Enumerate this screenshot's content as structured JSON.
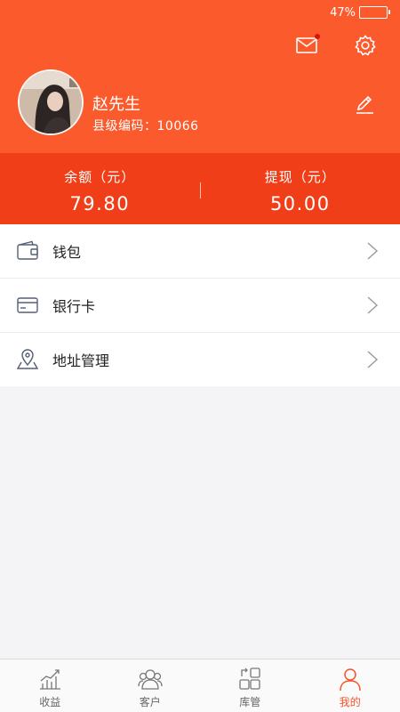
{
  "status_bar": {
    "battery_text": "47%",
    "battery_level": 0.47
  },
  "user": {
    "name": "赵先生",
    "code_line": "县级编码：10066"
  },
  "balance": {
    "left": {
      "label": "余额（元）",
      "value": "79.80"
    },
    "right": {
      "label": "提现（元）",
      "value": "50.00"
    }
  },
  "menu": [
    {
      "label": "钱包",
      "icon": "wallet-icon"
    },
    {
      "label": "银行卡",
      "icon": "bank-card-icon"
    },
    {
      "label": "地址管理",
      "icon": "location-icon"
    }
  ],
  "tabs": [
    {
      "label": "收益",
      "icon": "chart-icon",
      "active": false
    },
    {
      "label": "客户",
      "icon": "users-icon",
      "active": false
    },
    {
      "label": "库管",
      "icon": "grid-icon",
      "active": false
    },
    {
      "label": "我的",
      "icon": "person-icon",
      "active": true
    }
  ],
  "colors": {
    "header": "#fb5a2c",
    "balance_band": "#f03f18",
    "accent": "#f5532a",
    "notification_dot": "#d9140a"
  }
}
